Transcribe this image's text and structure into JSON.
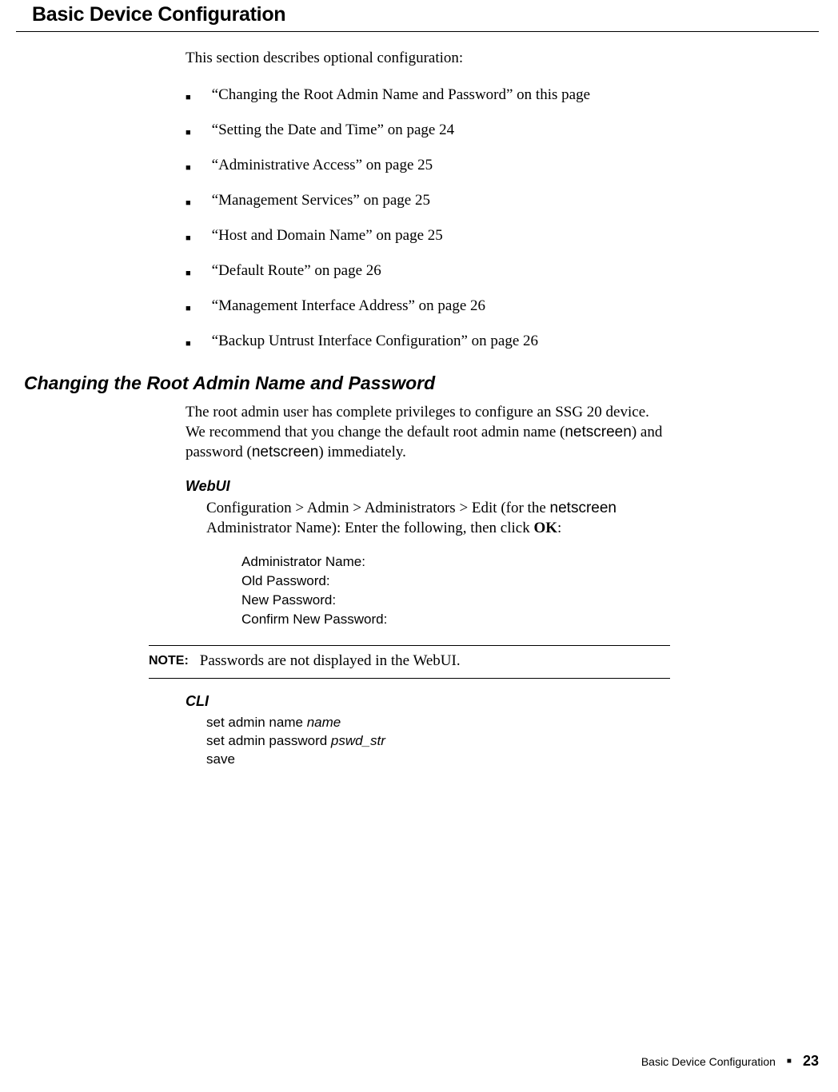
{
  "title": "Basic Device Configuration",
  "intro": "This section describes optional configuration:",
  "bullets": [
    "“Changing the Root Admin Name and Password” on this page",
    "“Setting the Date and Time” on page 24",
    "“Administrative Access” on page 25",
    "“Management Services” on page 25",
    "“Host and Domain Name” on page 25",
    "“Default Route” on page 26",
    "“Management Interface Address” on page 26",
    "“Backup Untrust Interface Configuration” on page 26"
  ],
  "section": {
    "heading": "Changing the Root Admin Name and Password",
    "para_pre": "The root admin user has complete privileges to configure an SSG 20 device. We recommend that you change the default root admin name (",
    "para_mid1": "netscreen",
    "para_mid2": ") and password (",
    "para_mid3": "netscreen",
    "para_post": ") immediately.",
    "webui_label": "WebUI",
    "webui_path_pre": "Configuration > Admin > Administrators > Edit (for the ",
    "webui_path_bold": "netscreen",
    "webui_path_mid": " Administrator Name): Enter the following, then click ",
    "webui_path_ok": "OK",
    "webui_path_post": ":",
    "fields": [
      "Administrator Name:",
      "Old Password:",
      "New Password:",
      "Confirm New Password:"
    ],
    "note_label": "NOTE:",
    "note_text": "Passwords are not displayed in the WebUI.",
    "cli_label": "CLI",
    "cli": {
      "l1a": "set admin name ",
      "l1b": "name",
      "l2a": "set admin password ",
      "l2b": "pswd_str",
      "l3": "save"
    }
  },
  "footer": {
    "text": "Basic Device Configuration",
    "page": "23"
  }
}
